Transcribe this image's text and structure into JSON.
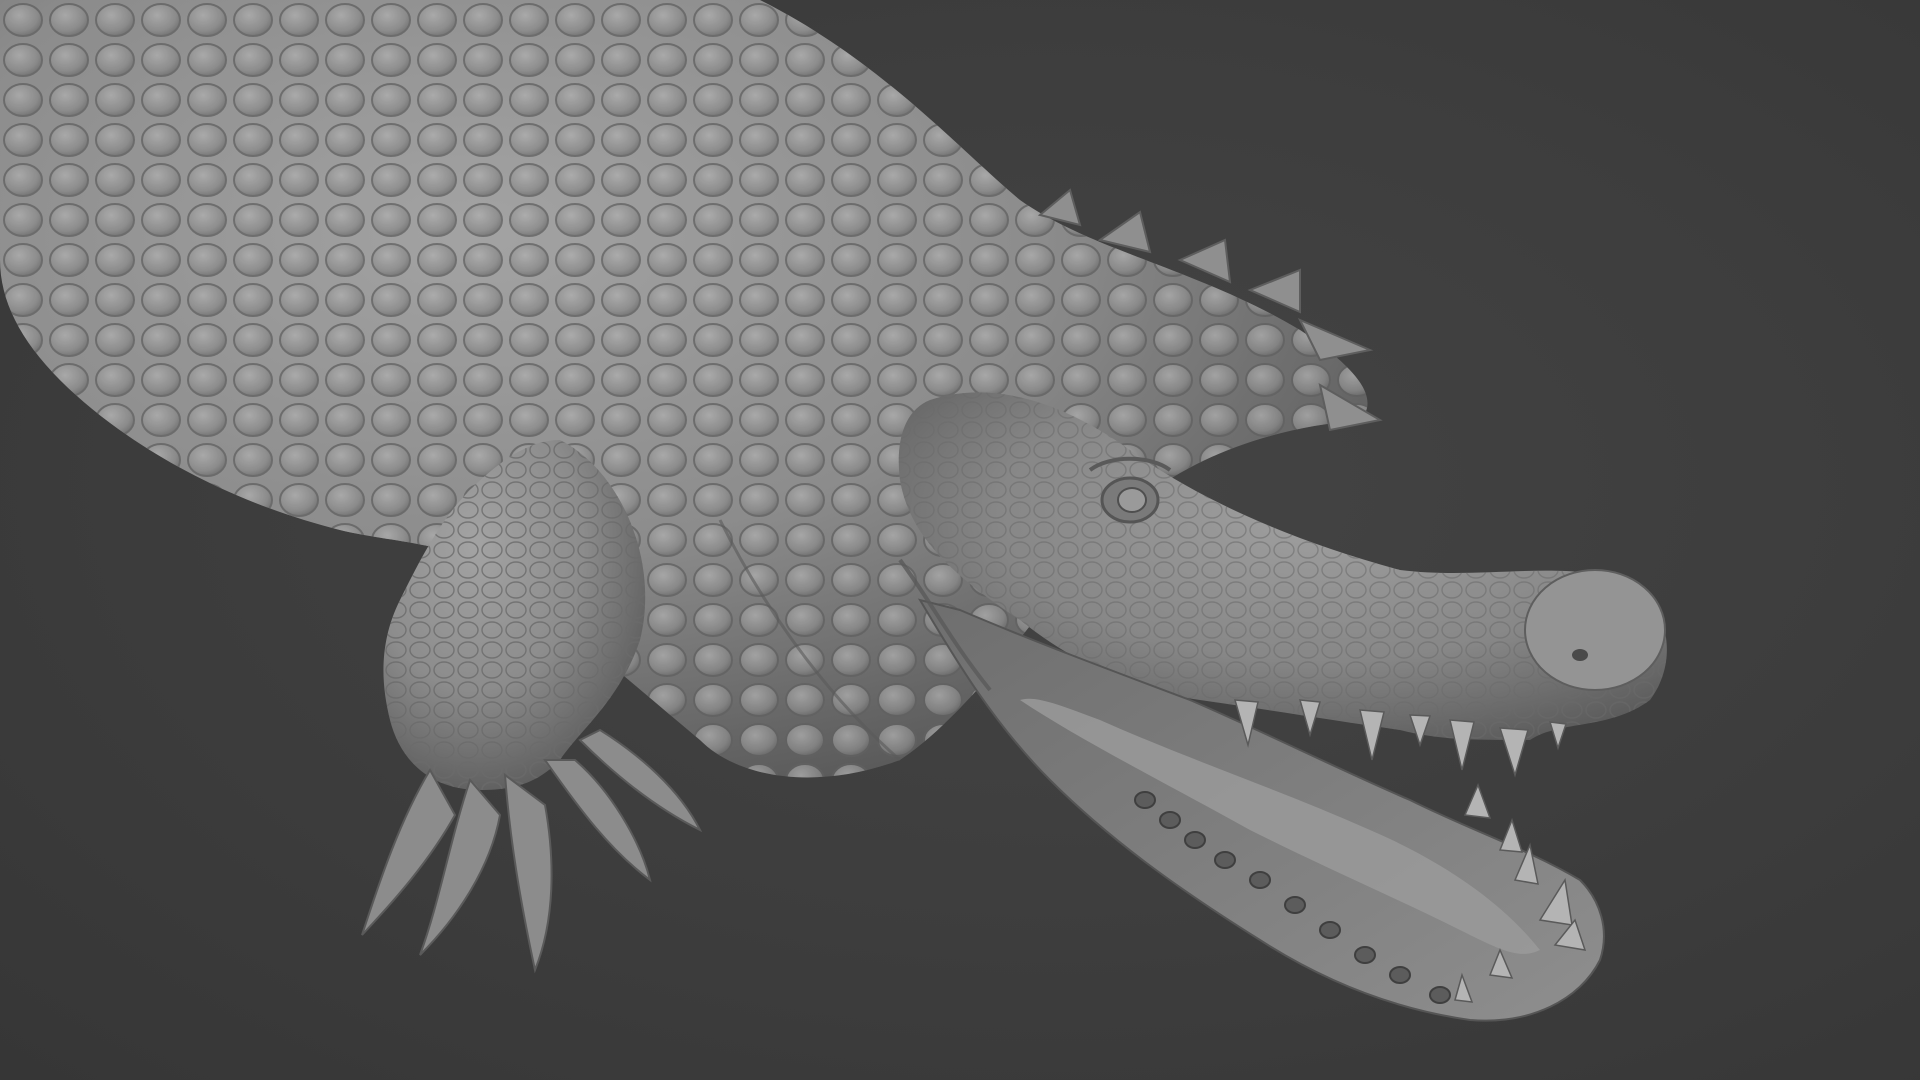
{
  "scene": {
    "subject": "crocodile-sculpt",
    "background_color": "#3c3c3c",
    "clay_color": "#8a8a8a",
    "clay_shadow_color": "#5e5e5e",
    "clay_highlight_color": "#a9a9a9"
  }
}
